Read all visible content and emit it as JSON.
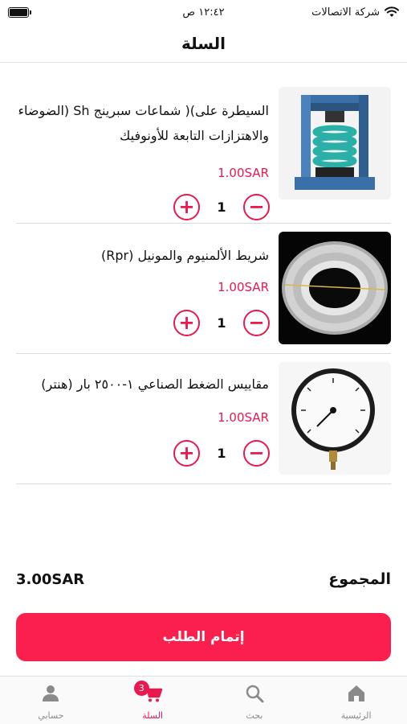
{
  "status_bar": {
    "carrier": "شركة الاتصالات",
    "time": "١٢:٤٢ ص"
  },
  "header": {
    "title": "السلة"
  },
  "cart": {
    "items": [
      {
        "name": "السيطرة على)( شماعات سبرينج Sh (الضوضاء والاهتزازات التابعة للأونوفيك",
        "price": "1.00SAR",
        "quantity": "1",
        "image_icon": "spring-isolator-image"
      },
      {
        "name": "شريط الألمنيوم والمونيل (Rpr)",
        "price": "1.00SAR",
        "quantity": "1",
        "image_icon": "aluminum-tape-roll-image"
      },
      {
        "name": "مقاييس الضغط الصناعي ١-٢٥٠٠ بار (هنتر)",
        "price": "1.00SAR",
        "quantity": "1",
        "image_icon": "pressure-gauge-image"
      }
    ]
  },
  "summary": {
    "total_label": "المجموع",
    "total_amount": "3.00SAR"
  },
  "checkout": {
    "label": "إتمام الطلب"
  },
  "bottom_nav": {
    "items": [
      {
        "label": "الرئيسية",
        "icon": "home-icon"
      },
      {
        "label": "بحث",
        "icon": "search-icon"
      },
      {
        "label": "السلة",
        "icon": "cart-icon",
        "badge": "3",
        "active": true
      },
      {
        "label": "حسابي",
        "icon": "user-icon"
      }
    ]
  },
  "colors": {
    "accent": "#e8194f",
    "button": "#fb1f4d",
    "divider": "#dcdcdc",
    "nav_inactive": "#8a8a8a"
  }
}
